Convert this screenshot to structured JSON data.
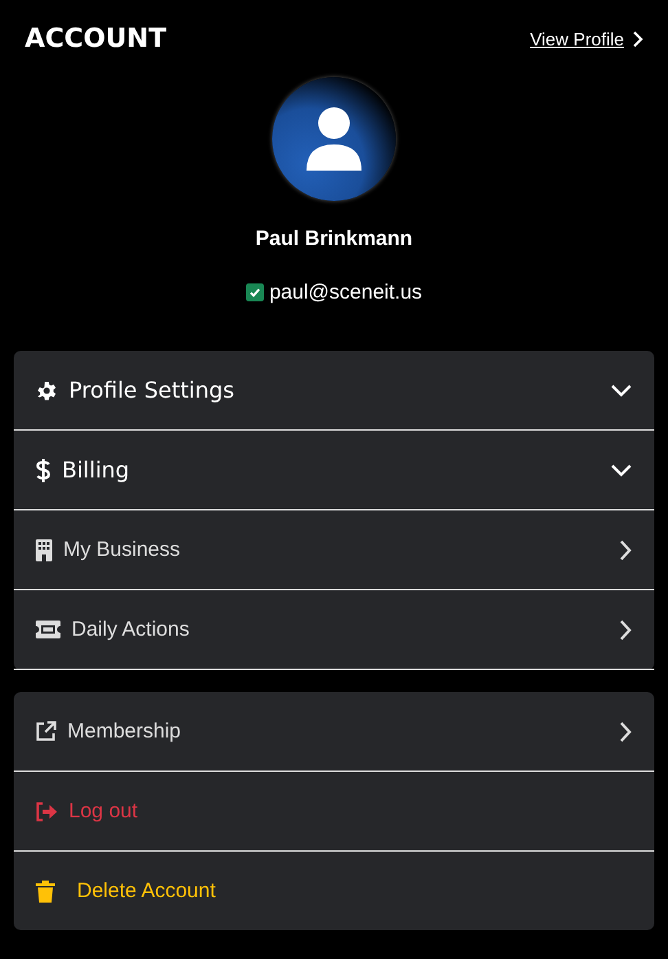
{
  "header": {
    "title": "ACCOUNT",
    "link": "View Profile"
  },
  "profile": {
    "name": "Paul Brinkmann",
    "email": "paul@sceneit.us",
    "verified": true
  },
  "sections": [
    {
      "items": [
        {
          "label": "Profile Settings",
          "kind": "accordion",
          "expanded": false
        },
        {
          "label": "Billing",
          "kind": "accordion",
          "expanded": false
        },
        {
          "label": "My Business",
          "kind": "link"
        },
        {
          "label": "Daily Actions",
          "kind": "link"
        }
      ]
    },
    {
      "items": [
        {
          "label": "Membership",
          "kind": "link"
        },
        {
          "label": "Log out",
          "kind": "danger"
        },
        {
          "label": "Delete Account",
          "kind": "warning"
        }
      ]
    }
  ]
}
